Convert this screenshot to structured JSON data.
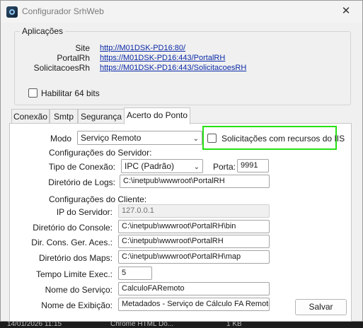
{
  "window": {
    "title": "Configurador SrhWeb",
    "close_glyph": "✕"
  },
  "apps_group": {
    "title": "Aplicações",
    "rows": [
      {
        "label": "Site",
        "url": "http://M01DSK-PD16:80/"
      },
      {
        "label": "PortalRh",
        "url": "https://M01DSK-PD16:443/PortalRH"
      },
      {
        "label": "SolicitacoesRh",
        "url": "https://M01DSK-PD16:443/SolicitacoesRH"
      }
    ],
    "enable64": {
      "label": "Habilitar 64 bits",
      "checked": false
    }
  },
  "tabs": [
    "Conexão",
    "Smtp",
    "Segurança",
    "Acerto do Ponto"
  ],
  "active_tab": "Acerto do Ponto",
  "form": {
    "mode": {
      "label": "Modo",
      "value": "Serviço Remoto"
    },
    "iis_checkbox": {
      "label": "Solicitações com recursos do IIS",
      "checked": false,
      "highlight_color": "#26e012"
    },
    "server_section": "Configurações do Servidor:",
    "connection_type": {
      "label": "Tipo de Conexão:",
      "value": "IPC (Padrão)"
    },
    "port": {
      "label": "Porta:",
      "value": "9991"
    },
    "log_dir": {
      "label": "Diretório de Logs:",
      "value": "C:\\inetpub\\wwwroot\\PortalRH"
    },
    "client_section": "Configurações do Cliente:",
    "server_ip": {
      "label": "IP do Servidor:",
      "value": "127.0.0.1"
    },
    "console_dir": {
      "label": "Diretório do Console:",
      "value": "C:\\inetpub\\wwwroot\\PortalRH\\bin"
    },
    "cons_ger_dir": {
      "label": "Dir. Cons. Ger. Aces.:",
      "value": "C:\\inetpub\\wwwroot\\PortalRH"
    },
    "maps_dir": {
      "label": "Diretório dos Maps:",
      "value": "C:\\inetpub\\wwwroot\\PortalRH\\map"
    },
    "timeout": {
      "label": "Tempo Limite Exec.:",
      "value": "5"
    },
    "service_name": {
      "label": "Nome do Serviço:",
      "value": "CalculoFARemoto"
    },
    "display_name": {
      "label": "Nome de Exibição:",
      "value": "Metadados - Serviço de Cálculo FA Remoto"
    },
    "save_button": "Salvar"
  },
  "taskbar": {
    "datetime": "14/01/2026 11:15",
    "app": "Chrome HTML Do...",
    "size": "1 KB"
  }
}
